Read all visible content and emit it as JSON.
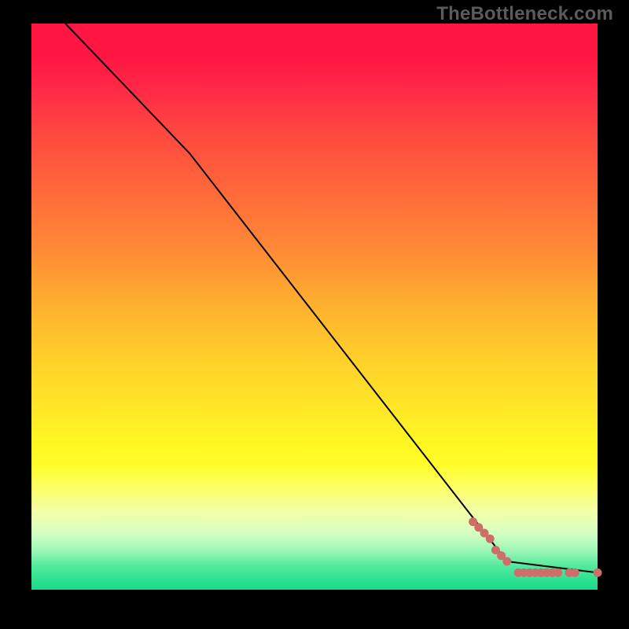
{
  "watermark": "TheBottleneck.com",
  "chart_data": {
    "type": "line",
    "title": "",
    "xlabel": "",
    "ylabel": "",
    "xlim": [
      0,
      100
    ],
    "ylim": [
      0,
      100
    ],
    "grid": false,
    "series": [
      {
        "name": "curve-black",
        "style": "line",
        "color": "#000000",
        "x": [
          6,
          28,
          84,
          100
        ],
        "y": [
          100,
          77,
          5,
          3
        ]
      },
      {
        "name": "points-coral",
        "style": "scatter",
        "color": "#cd6f68",
        "x": [
          78,
          79,
          80,
          81,
          82,
          83,
          84,
          86,
          87,
          88,
          89,
          90,
          91,
          92,
          93,
          95,
          96,
          100
        ],
        "y": [
          12,
          11,
          10,
          9,
          7,
          6,
          5,
          3,
          3,
          3,
          3,
          3,
          3,
          3,
          3,
          3,
          3,
          3
        ]
      }
    ],
    "background_gradient": {
      "top": "#ff1643",
      "middle": "#ffe728",
      "bottom": "#17db88"
    }
  }
}
